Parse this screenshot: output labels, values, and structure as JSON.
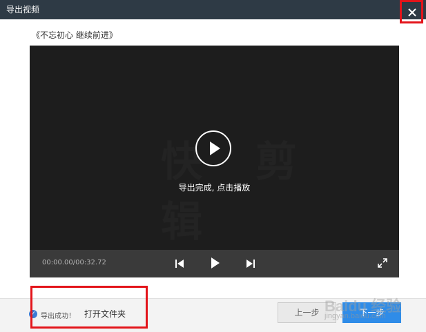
{
  "window": {
    "title": "导出视频"
  },
  "document": {
    "title": "《不忘初心 继续前进》"
  },
  "player": {
    "watermark": "快 剪 辑",
    "status_message": "导出完成, 点击播放",
    "timecode": "00:00.00/00:32.72"
  },
  "footer": {
    "status": "导出成功！",
    "open_folder_link": "打开文件夹",
    "prev_button": "上一步",
    "next_button": "下一步"
  },
  "watermark": {
    "brand": "Baidu 经验",
    "url": "jingyan.baidu.com"
  },
  "icons": [
    "close-icon",
    "play-icon",
    "previous-frame-icon",
    "next-frame-icon",
    "fullscreen-icon",
    "info-icon"
  ],
  "colors": {
    "titlebar": "#2e3a45",
    "accent": "#2f8ce8",
    "highlight": "#e3141a"
  }
}
